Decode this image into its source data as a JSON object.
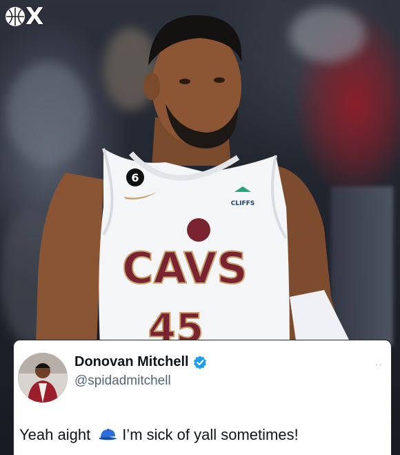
{
  "image": {
    "subject": "basketball-player-photo",
    "jersey": {
      "team_text": "CAVS",
      "number_text": "45",
      "patch_number": "6",
      "sponsor_text": "CLIFFS"
    }
  },
  "brand": {
    "logo_text": "X",
    "icon": "basketball-icon"
  },
  "tweet": {
    "display_name": "Donovan Mitchell",
    "handle": "@spidadmitchell",
    "verified_icon": "verified-badge-icon",
    "more_icon": "more-icon",
    "more_text": "··",
    "text_before": "Yeah aight",
    "emoji_icon": "blue-cap-icon",
    "text_after": "I’m sick of yall sometimes!"
  },
  "colors": {
    "verified": "#1d9bf0",
    "cavs_wine": "#7a2431",
    "cavs_gold": "#c5a06a",
    "cap_blue": "#2b6fd6"
  }
}
